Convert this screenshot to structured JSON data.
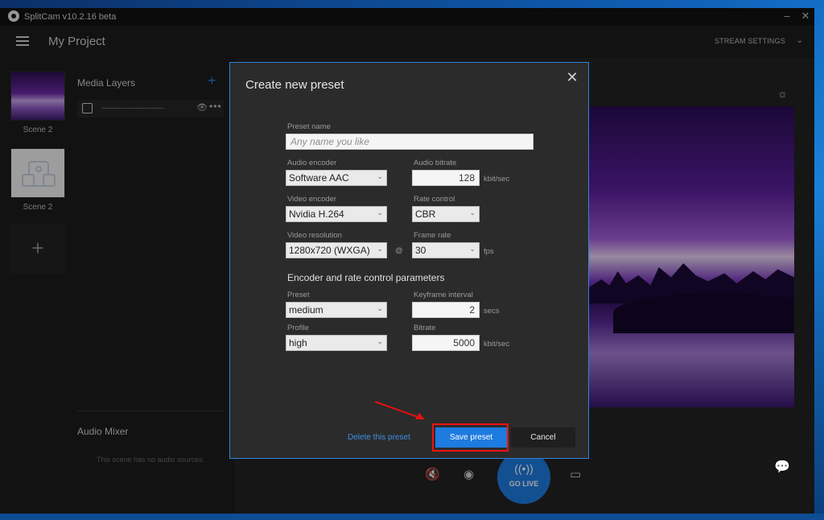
{
  "window": {
    "title": "SplitCam v10.2.16 beta",
    "minimize": "–",
    "close": "✕"
  },
  "header": {
    "project_title": "My Project",
    "stream_settings": "STREAM SETTINGS",
    "chevron": "⌄"
  },
  "scenes": [
    {
      "label": "Scene 2",
      "thumb": "purple-landscape"
    },
    {
      "label": "Scene 2",
      "thumb": "media-placeholder"
    }
  ],
  "scenes_add": "+",
  "media_layers": {
    "title": "Media Layers",
    "add": "+",
    "row_name": "--------------------------",
    "eye": "👁",
    "more": "•••"
  },
  "audio_mixer": {
    "title": "Audio Mixer",
    "empty": "This scene has no audio sources."
  },
  "bottom": {
    "go_live": "GO LIVE",
    "go_live_icon": "((•))",
    "mute_icon": "🔇",
    "camera_icon": "◉",
    "video_icon": "▭",
    "chat_icon": "💬"
  },
  "dialog": {
    "title": "Create new preset",
    "close": "✕",
    "preset_name": {
      "label": "Preset name",
      "placeholder": "Any name you like",
      "value": ""
    },
    "audio_encoder": {
      "label": "Audio encoder",
      "value": "Software AAC"
    },
    "audio_bitrate": {
      "label": "Audio bitrate",
      "value": "128",
      "unit": "kbit/sec"
    },
    "video_encoder": {
      "label": "Video encoder",
      "value": "Nvidia H.264"
    },
    "rate_control": {
      "label": "Rate control",
      "value": "CBR"
    },
    "video_resolution": {
      "label": "Video resolution",
      "value": "1280x720 (WXGA)"
    },
    "at": "@",
    "frame_rate": {
      "label": "Frame rate",
      "value": "30",
      "unit": "fps"
    },
    "section_title": "Encoder and rate control parameters",
    "preset": {
      "label": "Preset",
      "value": "medium"
    },
    "keyframe_interval": {
      "label": "Keyframe interval",
      "value": "2",
      "unit": "secs"
    },
    "profile": {
      "label": "Profile",
      "value": "high"
    },
    "bitrate": {
      "label": "Bitrate",
      "value": "5000",
      "unit": "kbit/sec"
    },
    "delete_link": "Delete this preset",
    "save_button": "Save preset",
    "cancel_button": "Cancel"
  },
  "colors": {
    "accent": "#1e7be0",
    "highlight": "#e11111",
    "dialog_border": "#2f83d8"
  }
}
